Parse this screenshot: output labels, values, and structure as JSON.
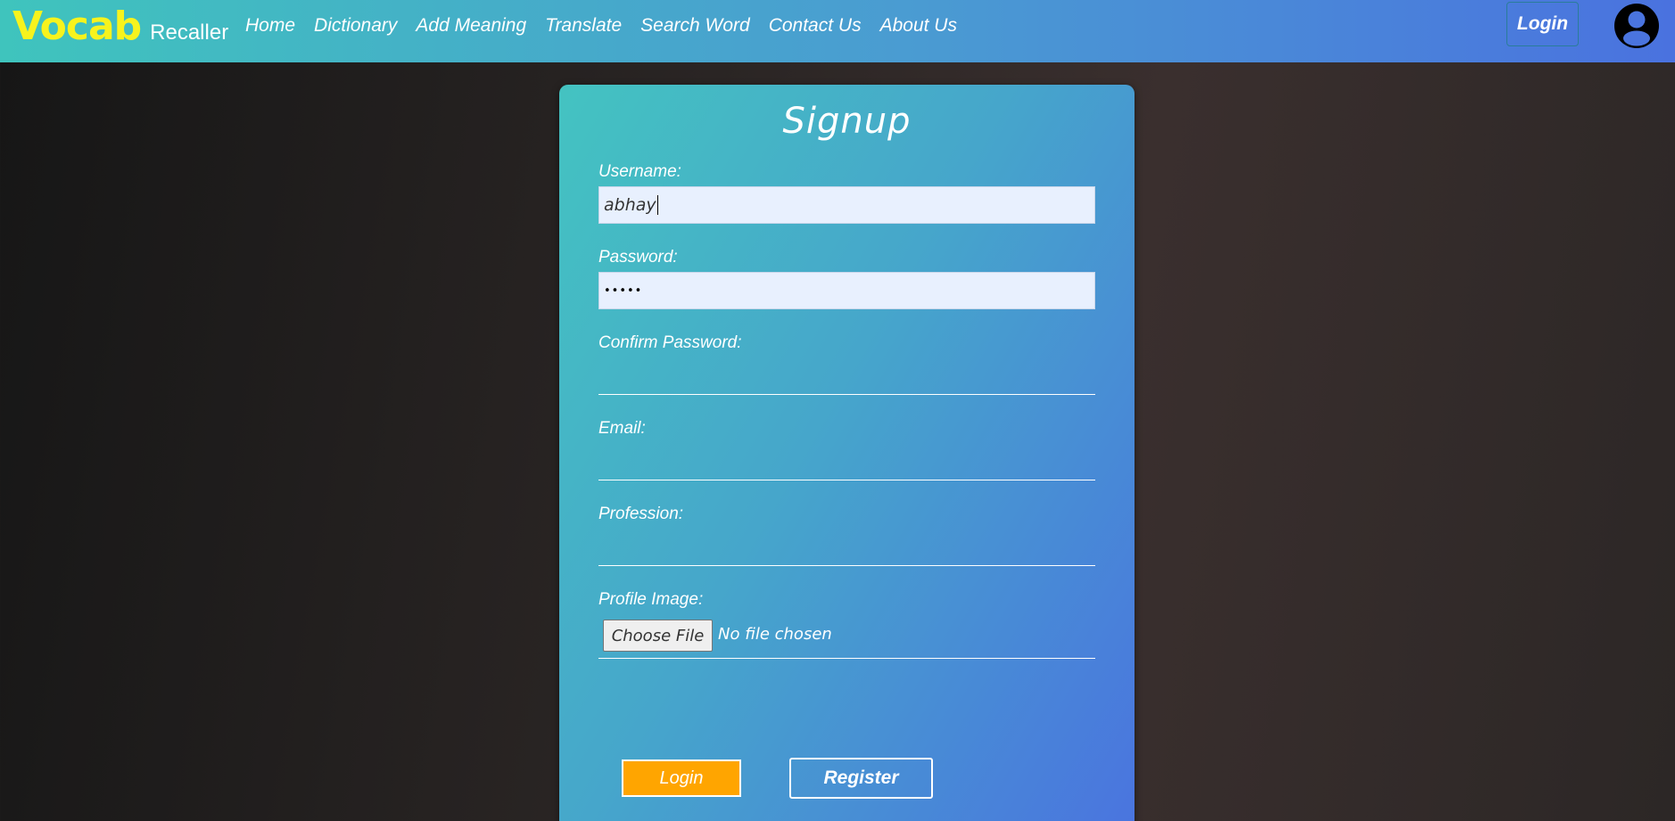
{
  "brand": {
    "main": "Vocab",
    "sub": "Recaller"
  },
  "nav": {
    "links": [
      "Home",
      "Dictionary",
      "Add Meaning",
      "Translate",
      "Search Word",
      "Contact Us",
      "About Us"
    ],
    "login_label": "Login",
    "avatar_icon": "user-circle-icon"
  },
  "form": {
    "title": "Signup",
    "username": {
      "label": "Username:",
      "value": "abhay"
    },
    "password": {
      "label": "Password:",
      "value": "•••••"
    },
    "confirm_password": {
      "label": "Confirm Password:",
      "value": ""
    },
    "email": {
      "label": "Email:",
      "value": ""
    },
    "profession": {
      "label": "Profession:",
      "value": ""
    },
    "profile_image": {
      "label": "Profile Image:",
      "button_label": "Choose File",
      "status": "No file chosen"
    },
    "login_button": "Login",
    "register_button": "Register"
  },
  "colors": {
    "brand_main": "#f7f31d",
    "navbar_start": "#3fc4bd",
    "navbar_end": "#4a72df",
    "login_button_bg": "#ffa500",
    "input_bg": "#e8f0fe"
  }
}
